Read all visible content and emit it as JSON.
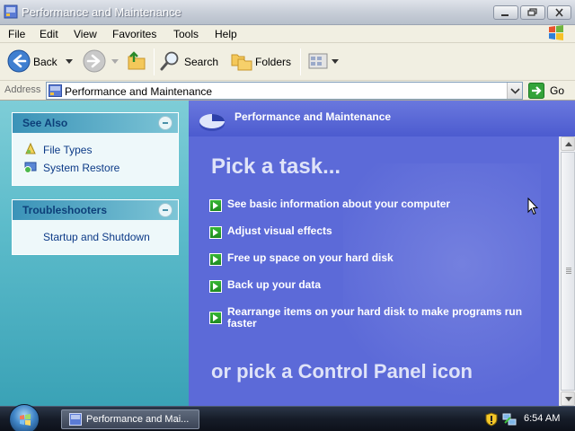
{
  "window": {
    "title": "Performance and Maintenance"
  },
  "menu": {
    "items": [
      "File",
      "Edit",
      "View",
      "Favorites",
      "Tools",
      "Help"
    ]
  },
  "toolbar": {
    "back_label": "Back",
    "search_label": "Search",
    "folders_label": "Folders"
  },
  "address": {
    "label": "Address",
    "value": "Performance and Maintenance",
    "go_label": "Go"
  },
  "see_also": {
    "title": "See Also",
    "links": [
      "File Types",
      "System Restore"
    ]
  },
  "troubleshooters": {
    "title": "Troubleshooters",
    "links": [
      "Startup and Shutdown"
    ]
  },
  "main": {
    "header_title": "Performance and Maintenance",
    "pick_task": "Pick a task...",
    "tasks": [
      "See basic information about your computer",
      "Adjust visual effects",
      "Free up space on your hard disk",
      "Back up your data",
      "Rearrange items on your hard disk to make programs run faster"
    ],
    "or_pick": "or pick a Control Panel icon"
  },
  "taskbar": {
    "window_button": "Performance and Mai...",
    "clock": "6:54 AM"
  },
  "colors": {
    "task_pane_blue": "#5968d6",
    "left_pane_teal": "#5dbccb",
    "link_blue": "#0c3a87",
    "task_arrow_green": "#36b635"
  }
}
